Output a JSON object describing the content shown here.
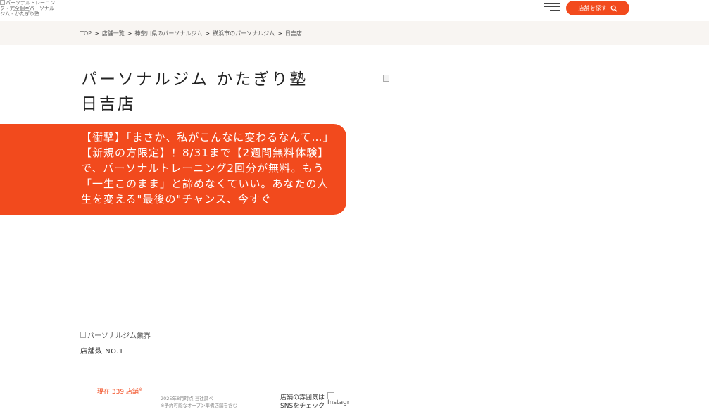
{
  "header": {
    "logo_alt": "パーソナルトレーニング・完全個室パーソナルジム - かたぎり塾",
    "search_label": "店舗を探す"
  },
  "breadcrumb": [
    "TOP",
    "店舗一覧",
    "神奈川県のパーソナルジム",
    "横浜市のパーソナルジム",
    "日吉店"
  ],
  "page": {
    "title_line1": "パーソナルジム かたぎり塾",
    "title_line2": "日吉店"
  },
  "campaign": {
    "text": "【衝撃】「まさか、私がこんなに変わるなんて…」【新規の方限定】！8/31まで【2週間無料体験】で、パーソナルトレーニング2回分が無料。もう「一生このまま」と諦めなくていい。あなたの人生を変える\"最後の\"チャンス、今すぐ"
  },
  "ranking": {
    "image_alt": "パーソナルジム業界",
    "text": "店舗数 NO.1"
  },
  "stats": {
    "current_label": "現在 339 店舗",
    "current_mark": "※",
    "note_line1": "2025年8月時点 当社調べ",
    "note_line2": "※予約可能なオープン準備店舗を含む"
  },
  "sns": {
    "text_line1": "店舗の雰囲気は",
    "text_line2": "SNSをチェック",
    "icon_alt": "Instagram"
  },
  "colors": {
    "accent": "#f24a1d",
    "breadcrumb_bg": "#f8f5f2"
  }
}
